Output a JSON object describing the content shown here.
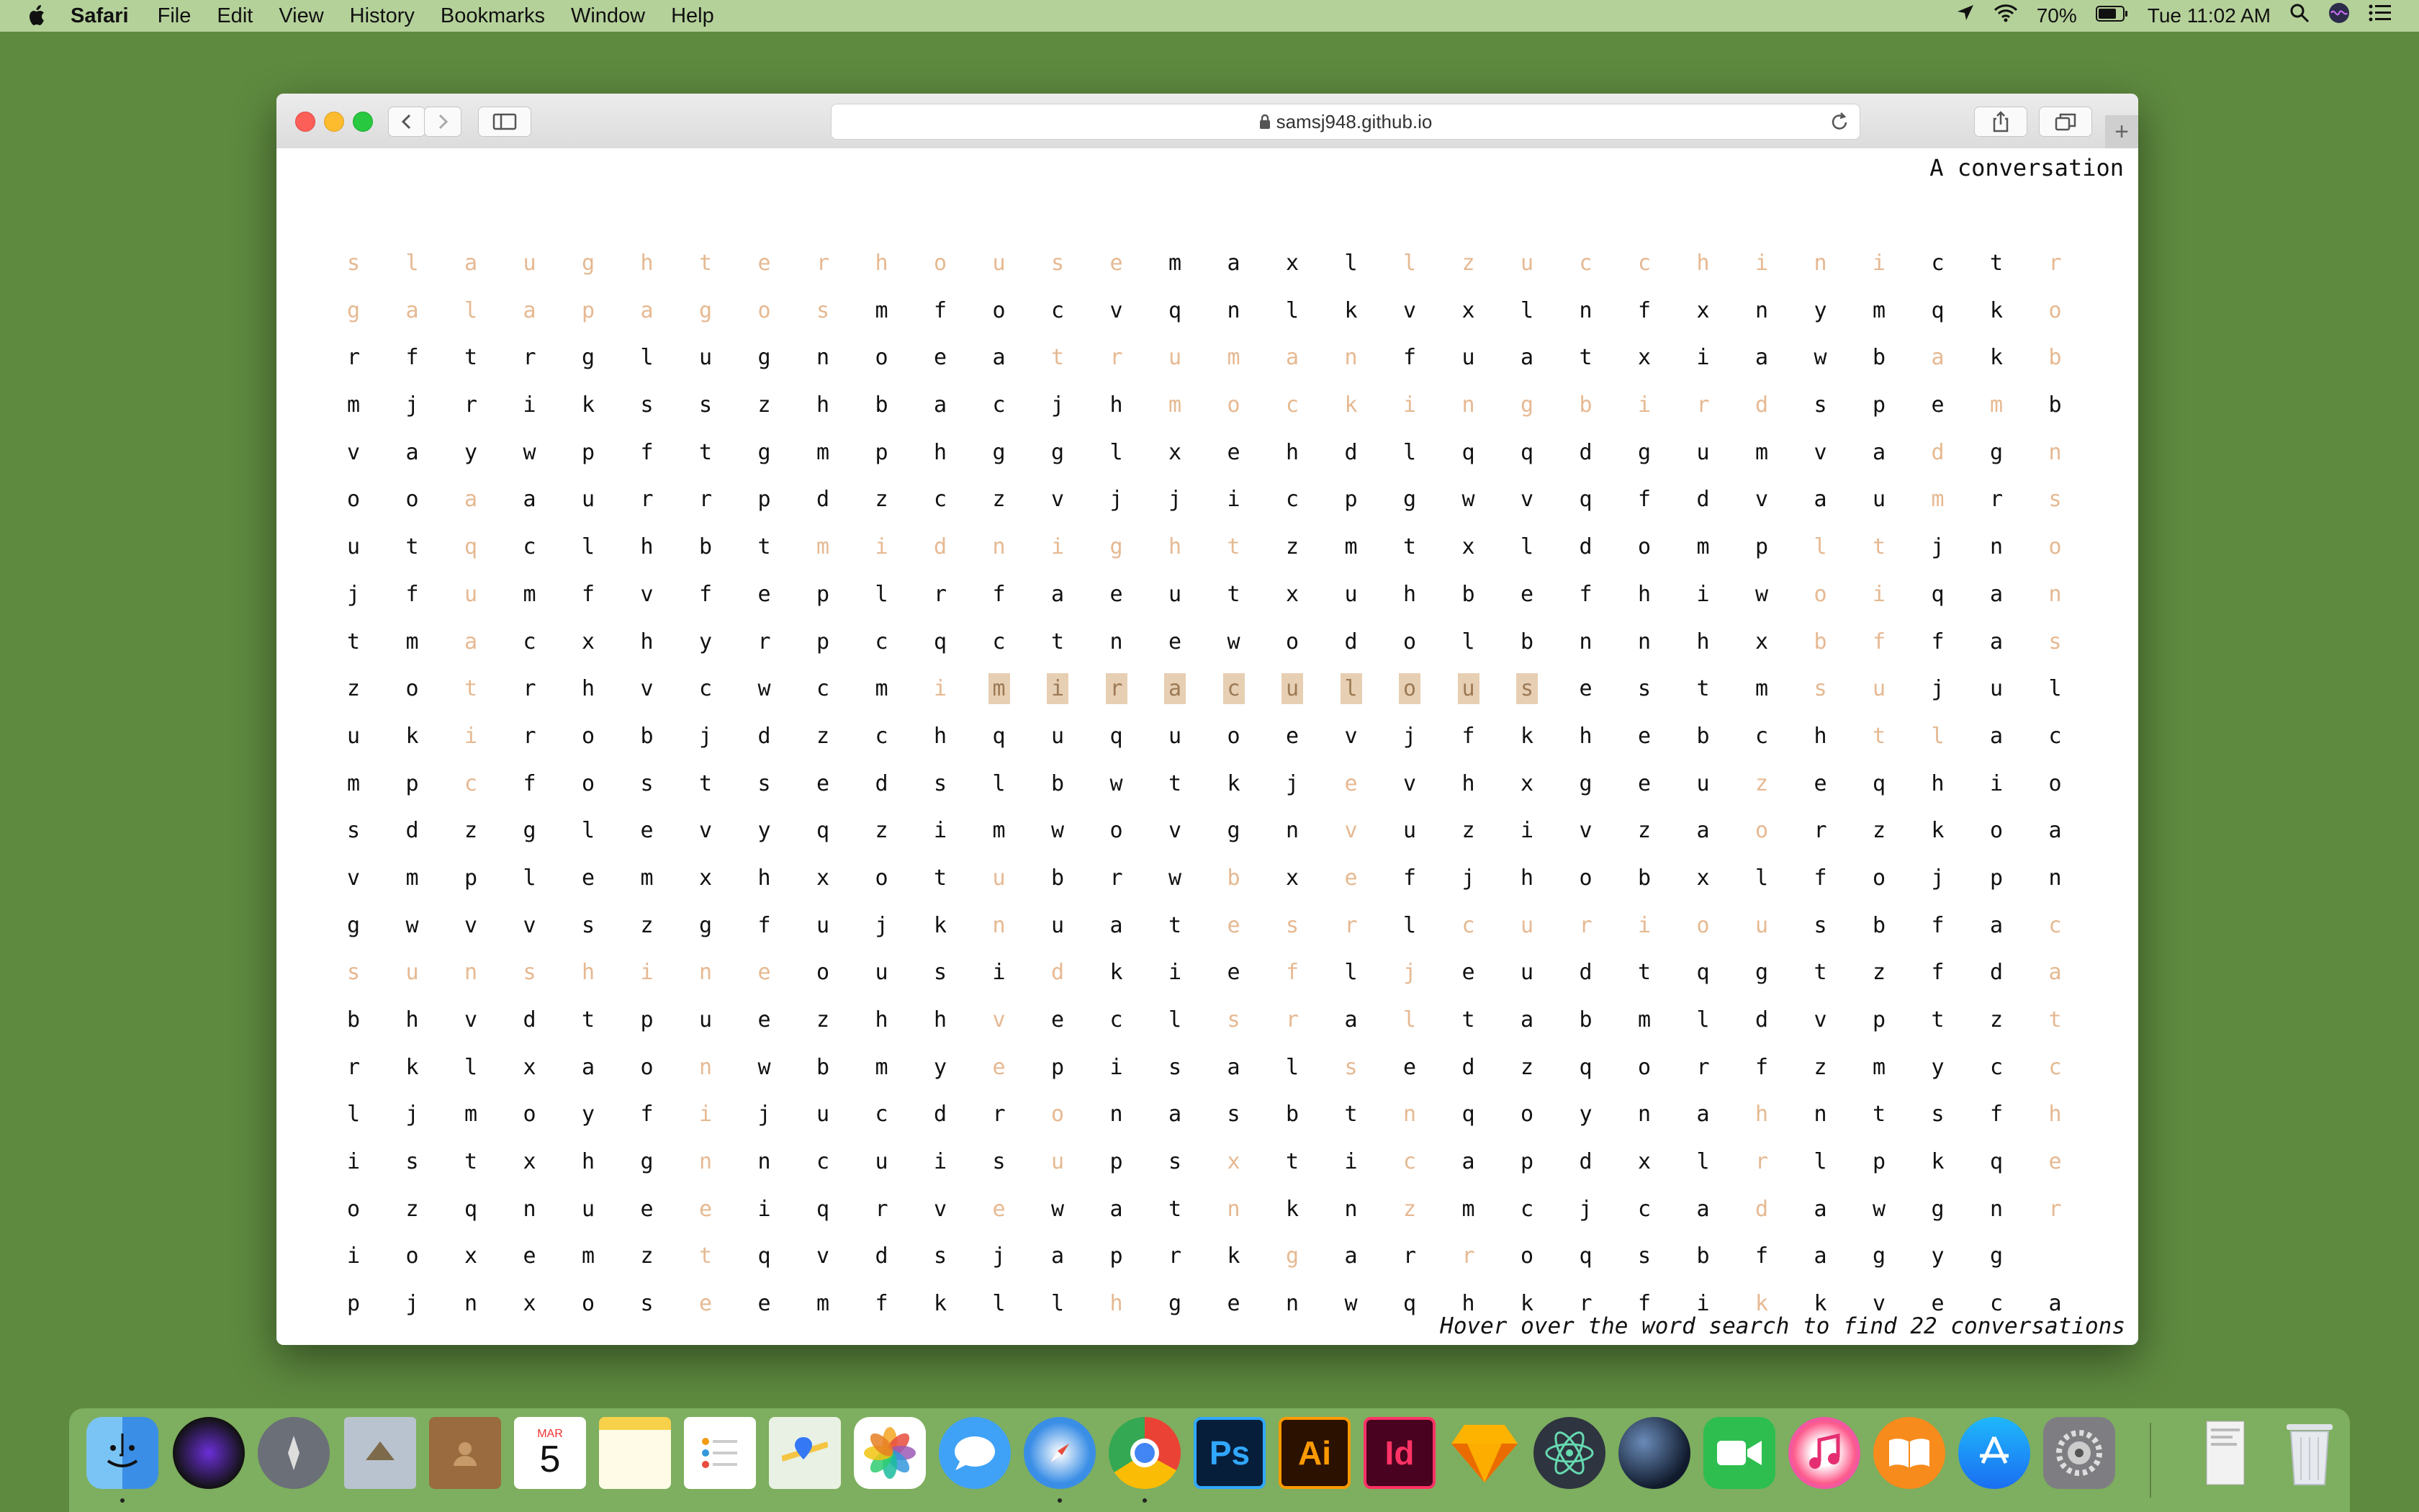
{
  "menubar": {
    "app_name": "Safari",
    "items": [
      "File",
      "Edit",
      "View",
      "History",
      "Bookmarks",
      "Window",
      "Help"
    ],
    "battery": "70%",
    "clock": "Tue 11:02 AM"
  },
  "browser": {
    "url": "samsj948.github.io"
  },
  "page": {
    "title": "A conversation",
    "hint": "Hover over the word search to find 22 conversations",
    "grid": [
      "slaughterhousemaxllzucchinictr",
      "galapagosmfocvqnlkvxlnfxnymqko",
      "rftrglugnoeatrumanfuatxiawbakb",
      "mjriksszhbacjhmockingbirdspembi",
      "vaywpftgmphggl xehdlqqdgumvadgn",
      "ooaaurrpdzczvjjicpgwvqfdvaumrs",
      "utqclhbtmidnightzmtxldompltjno",
      "jfumfvfeplrfaeutxuhbefhiwoiqan",
      "tmacxhyrpcqctnewodolbnnhxbffas",
      "zotrhvcwcmimiraculousestmsujul",
      "ukirobjdzchququoevjfkhebchtlacc",
      "mpcfostsedslbwtkjevhxgeuzeqhio",
      "sdzglevyqzimwovgnvuzivzaorzkoa",
      "vmplemxhxotubrwbxefjhobxlfojpn",
      "gwvvszgfujknuatesrlcuriousbfac",
      "sunshineousidkiefljeudtqgtzfda",
      "bhvdtpuezhhveclsraltabmldvptzt",
      "rklxaonwbmyepisalsedzqorfzmycc",
      "ljmoyfijucdronasbtnqoynahntsfh",
      "istxhgnncuisupsxticapdxlrlpkqe",
      "ozqnueeiqrvewatnknzmcjcadawgnr",
      "ioxemztqvdsjaprkgarroqsbfagyg",
      "pjnxoseemfkllhgenwqhkrfikkveca"
    ],
    "found_mask": [
      "111111111111110000111111111001",
      "111111111000000000000000000001",
      "000000000000111111000000000101",
      "0000000000000011111111111000101",
      "000000000000000000000000000101",
      "001000000000000000000000000101",
      "001000001111111100000000011001",
      "001000000000000000000000011001",
      "001000000000000000000000011001",
      "001000000011111111110000011000",
      "0010000000000000000000000011000",
      "001000000000000001000000100000",
      "000000000000000001000000100000",
      "000000000001000101000000000000",
      "000000000001000111011111100001",
      "111111110000100010100000000001",
      "000000000001000110100000000001",
      "000000100001000001000000000001",
      "000000100000100000100000100001",
      "000000100000100100100000100001",
      "000000100001000100100000100001",
      "000000100000000010010000000000",
      "000000100000010000000000100000"
    ],
    "highlight": {
      "row": 9,
      "word": "miraculous"
    }
  },
  "dock": {
    "calendar_month": "MAR",
    "calendar_day": "5",
    "photoshop_label": "Ps",
    "illustrator_label": "Ai",
    "indesign_label": "Id"
  },
  "colors": {
    "desktop": "#5e8a3f",
    "found_letter": "#e6b992",
    "highlight_bg": "#e7cfb3"
  }
}
